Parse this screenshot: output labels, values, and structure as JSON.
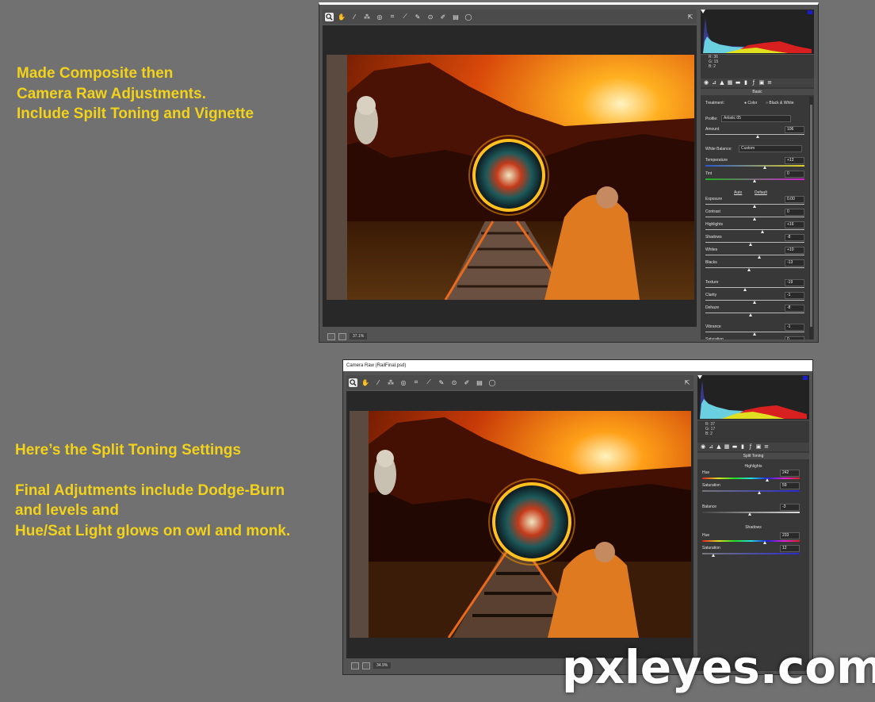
{
  "notes": {
    "top": [
      "Made Composite then",
      "Camera Raw Adjustments.",
      "Include Spilt Toning and Vignette"
    ],
    "bottom_heading": "Here’s the Split Toning Settings",
    "bottom": [
      "Final Adjutments include Dodge-Burn",
      "and levels and",
      "Hue/Sat Light glows on owl and monk."
    ]
  },
  "watermark": "pxleyes.com",
  "colors": {
    "note_text": "#f2d21a",
    "page_bg": "#717171",
    "panel_bg": "#383838"
  },
  "icons": [
    "zoom-icon",
    "hand-icon",
    "white-balance-icon",
    "color-sampler-icon",
    "target-adjust-icon",
    "crop-icon",
    "straighten-icon",
    "spot-removal-icon",
    "red-eye-icon",
    "adjustment-brush-icon",
    "graduated-filter-icon",
    "radial-filter-icon",
    "open-prefs-icon"
  ],
  "window1": {
    "zoom": "37.1%",
    "rgb": {
      "r": "R:   36",
      "g": "G:   15",
      "b": "B:    2"
    },
    "section": "Basic",
    "treatment_label": "Treatment:",
    "treatment_color": "Color",
    "treatment_bw": "Black & White",
    "profile_label": "Profile:",
    "profile_value": "Artistic 05",
    "amount": {
      "label": "Amount",
      "value": "106"
    },
    "wb_label": "White Balance:",
    "wb_value": "Custom",
    "auto": "Auto",
    "default": "Default",
    "sliders": [
      {
        "label": "Temperature",
        "value": "+12",
        "pos": 0.6
      },
      {
        "label": "Tint",
        "value": "0",
        "pos": 0.5
      },
      {
        "label": "Exposure",
        "value": "0.00",
        "pos": 0.5
      },
      {
        "label": "Contrast",
        "value": "0",
        "pos": 0.5
      },
      {
        "label": "Highlights",
        "value": "+16",
        "pos": 0.58
      },
      {
        "label": "Shadows",
        "value": "-8",
        "pos": 0.46
      },
      {
        "label": "Whites",
        "value": "+10",
        "pos": 0.55
      },
      {
        "label": "Blacks",
        "value": "-13",
        "pos": 0.44
      },
      {
        "label": "Texture",
        "value": "-19",
        "pos": 0.4
      },
      {
        "label": "Clarity",
        "value": "-1",
        "pos": 0.5
      },
      {
        "label": "Dehaze",
        "value": "-8",
        "pos": 0.46
      },
      {
        "label": "Vibrance",
        "value": "-1",
        "pos": 0.5
      },
      {
        "label": "Saturation",
        "value": "0",
        "pos": 0.5
      }
    ]
  },
  "window2": {
    "title": "Camera Raw (RailFinal.psd)",
    "zoom": "34.9%",
    "rgb": {
      "r": "R:   37",
      "g": "G:   17",
      "b": "B:    2"
    },
    "section": "Split Toning",
    "highlights_label": "Highlights",
    "shadows_label": "Shadows",
    "sliders": [
      {
        "label": "Hue",
        "value": "242",
        "pos": 0.67
      },
      {
        "label": "Saturation",
        "value": "59",
        "pos": 0.59
      },
      {
        "label": "Balance",
        "value": "-3",
        "pos": 0.49
      },
      {
        "label": "Hue",
        "value": "233",
        "pos": 0.65
      },
      {
        "label": "Saturation",
        "value": "12",
        "pos": 0.12
      }
    ]
  }
}
